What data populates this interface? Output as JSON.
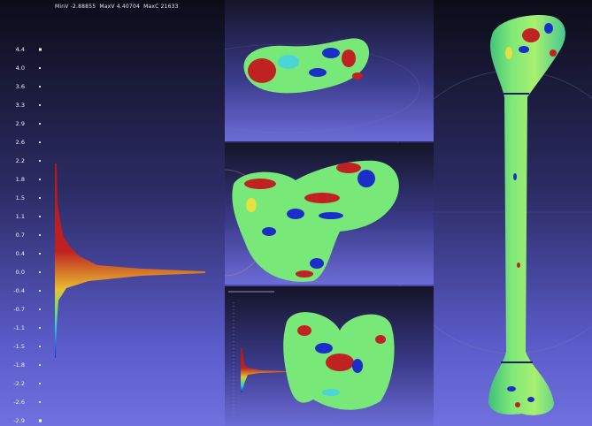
{
  "stats": {
    "minv": "MinV -2.88855",
    "maxv": "MaxV 4.40704",
    "maxc": "MaxC 21633"
  },
  "scale_ticks": [
    "4.4",
    "4.0",
    "3.6",
    "3.3",
    "2.9",
    "2.6",
    "2.2",
    "1.8",
    "1.5",
    "1.1",
    "0.7",
    "0.4",
    "0.0",
    "-0.4",
    "-0.7",
    "-1.1",
    "-1.5",
    "-1.8",
    "-2.2",
    "-2.6",
    "-2.9"
  ],
  "colors": {
    "red": "#c02222",
    "blue": "#1a2ec8",
    "green": "#78e878",
    "cyan": "#4ad6d6",
    "yellow": "#e6e040"
  }
}
